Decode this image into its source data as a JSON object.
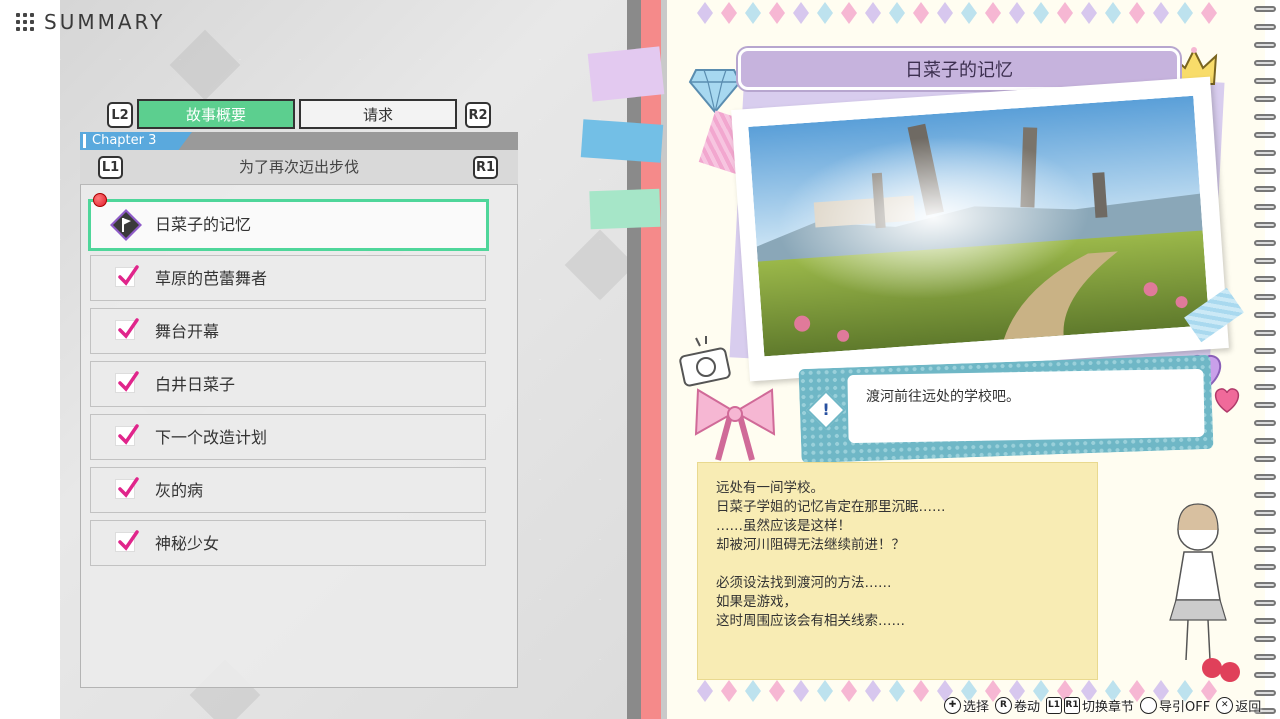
{
  "header": {
    "title": "SUMMARY"
  },
  "tabs": {
    "left_key": "L2",
    "right_key": "R2",
    "items": [
      {
        "label": "故事概要",
        "selected": true
      },
      {
        "label": "请求",
        "selected": false
      }
    ]
  },
  "chapter": {
    "label": "Chapter 3",
    "left_key": "L1",
    "right_key": "R1",
    "name": "为了再次迈出步伐"
  },
  "episodes": [
    {
      "label": "日菜子的记忆",
      "status": "current",
      "icon": "diamond-flag-icon"
    },
    {
      "label": "草原的芭蕾舞者",
      "status": "done"
    },
    {
      "label": "舞台开幕",
      "status": "done"
    },
    {
      "label": "白井日菜子",
      "status": "done"
    },
    {
      "label": "下一个改造计划",
      "status": "done"
    },
    {
      "label": "灰的病",
      "status": "done"
    },
    {
      "label": "神秘少女",
      "status": "done"
    }
  ],
  "detail": {
    "title": "日菜子的记忆",
    "objective_icon": "!",
    "objective": "渡河前往远处的学校吧。",
    "notes": "远处有一间学校。\n日菜子学姐的记忆肯定在那里沉眠……\n……虽然应该是这样！\n却被河川阻碍无法继续前进！？\n\n必须设法找到渡河的方法……\n如果是游戏，\n这时周围应该会有相关线索……"
  },
  "footer": [
    {
      "key": "✚",
      "label": "选择"
    },
    {
      "key": "R",
      "label": "卷动"
    },
    {
      "key": "L1",
      "key2": "R1",
      "label": "切换章节"
    },
    {
      "key": "",
      "label": "导引OFF"
    },
    {
      "key": "✕",
      "label": "返回"
    }
  ],
  "colors": {
    "accent_green": "#5ccf8f",
    "active_border": "#4fd69a",
    "check_magenta": "#e0258b",
    "chapter_blue": "#5aa9dd",
    "banner_lilac": "#c6b3dd",
    "note_yellow": "#f8ecb4",
    "binding_red": "#f58a8a"
  }
}
